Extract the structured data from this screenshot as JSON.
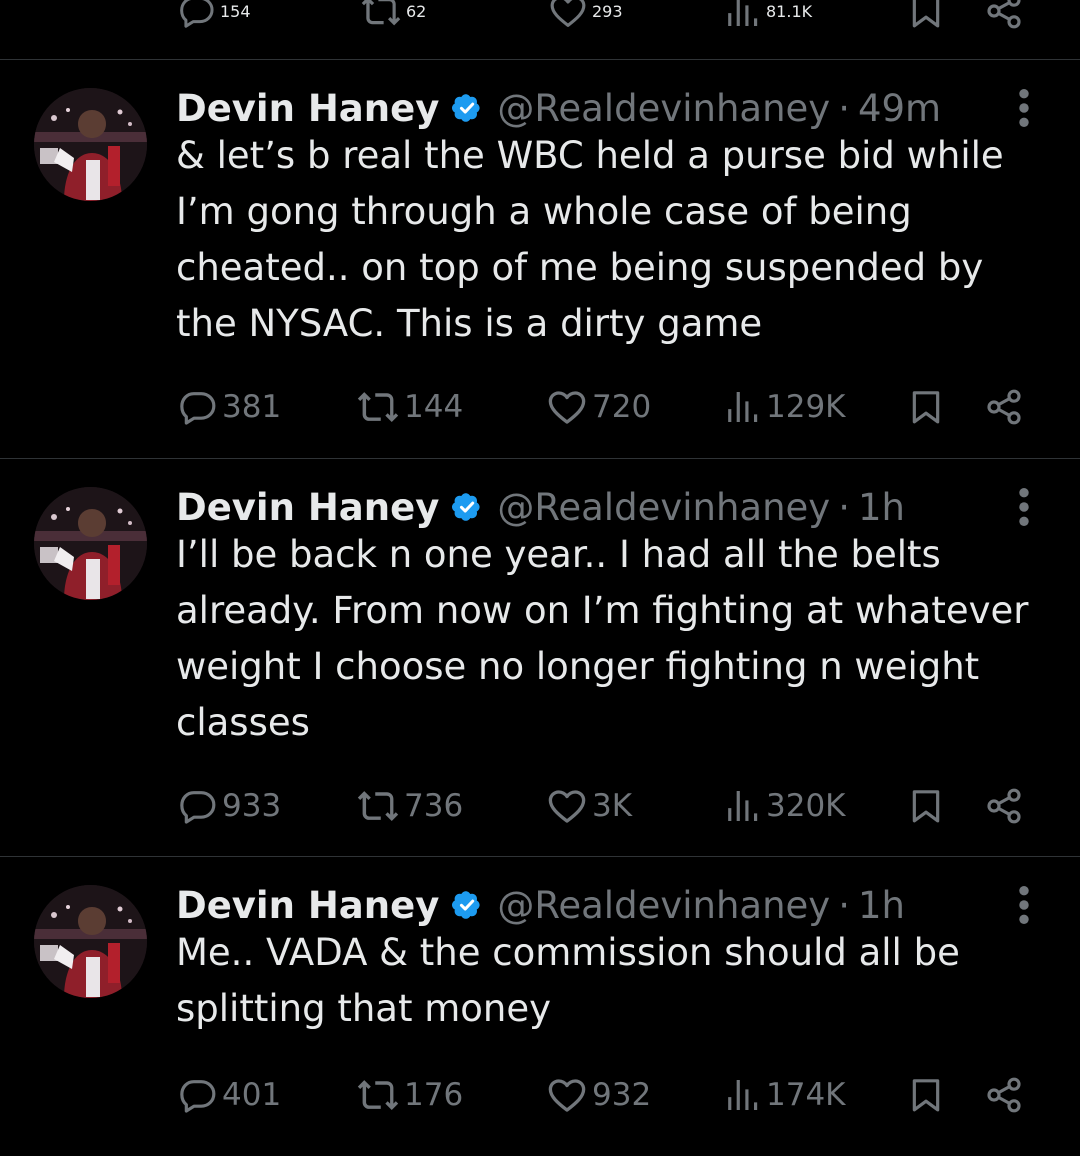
{
  "top_actions": {
    "replies": "154",
    "reposts": "62",
    "likes": "293",
    "views": "81.1K"
  },
  "tweets": [
    {
      "name": "Devin Haney",
      "handle": "@Realdevinhaney",
      "separator": "·",
      "time": "49m",
      "text": "& let’s b real the WBC held a purse bid while\nI’m gong through a whole case of being\ncheated.. on top of me being suspended by\nthe NYSAC. This is a dirty game",
      "replies": "381",
      "reposts": "144",
      "likes": "720",
      "views": "129K"
    },
    {
      "name": "Devin Haney",
      "handle": "@Realdevinhaney",
      "separator": "·",
      "time": "1h",
      "text": "I’ll be back n one year.. I had all the belts\nalready. From now on I’m fighting at whatever\nweight I choose no longer fighting n weight\nclasses",
      "replies": "933",
      "reposts": "736",
      "likes": "3K",
      "views": "320K"
    },
    {
      "name": "Devin Haney",
      "handle": "@Realdevinhaney",
      "separator": "·",
      "time": "1h",
      "text": "Me.. VADA & the commission should all be\nsplitting that money",
      "replies": "401",
      "reposts": "176",
      "likes": "932",
      "views": "174K"
    }
  ],
  "colors": {
    "background": "#000000",
    "text": "#e7e9ea",
    "secondary": "#71767b",
    "divider": "#2f3336",
    "verified": "#1d9bf0"
  }
}
